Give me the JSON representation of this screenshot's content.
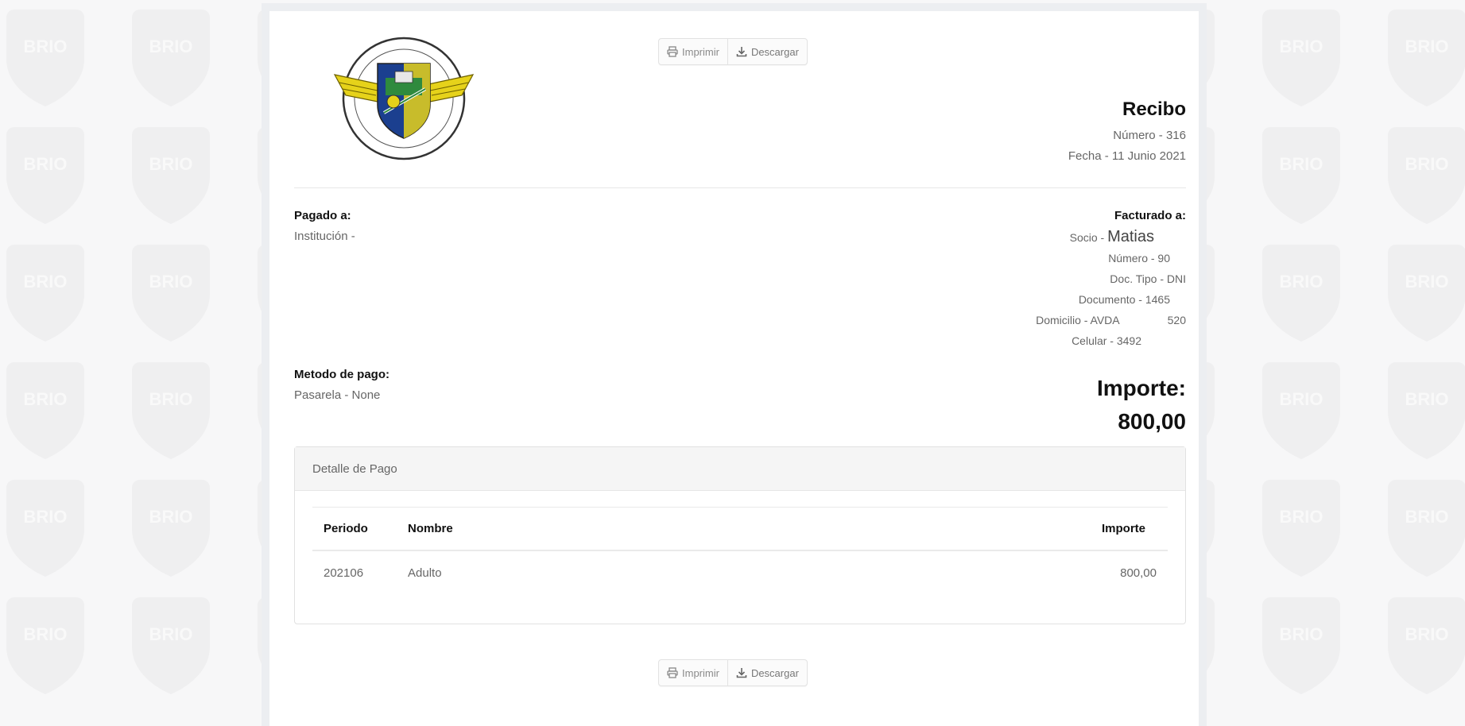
{
  "toolbar": {
    "print_label": "Imprimir",
    "download_label": "Descargar"
  },
  "receipt": {
    "title": "Recibo",
    "number": "Número - 316",
    "date": "Fecha - 11 Junio 2021"
  },
  "paid_to": {
    "label": "Pagado a:",
    "institution": "Institución -"
  },
  "billed_to": {
    "label": "Facturado a:",
    "socio_prefix": "Socio -",
    "socio_name": "Matias",
    "numero": "Número - 90",
    "doc_tipo": "Doc. Tipo - DNI",
    "documento": "Documento - 1465",
    "domicilio": "Domicilio - AVDA",
    "domicilio_num": "520",
    "celular": "Celular - 3492"
  },
  "payment_method": {
    "label": "Metodo de pago:",
    "value": "Pasarela - None"
  },
  "amount": {
    "label": "Importe:",
    "value": "800,00"
  },
  "detail": {
    "title": "Detalle de Pago",
    "columns": [
      "Periodo",
      "Nombre",
      "Importe"
    ],
    "rows": [
      {
        "periodo": "202106",
        "nombre": "Adulto",
        "importe": "800,00"
      }
    ]
  },
  "colors": {
    "background": "#f7f7f8",
    "watermark": "#eeeeef",
    "panel_header": "#f5f5f5"
  }
}
